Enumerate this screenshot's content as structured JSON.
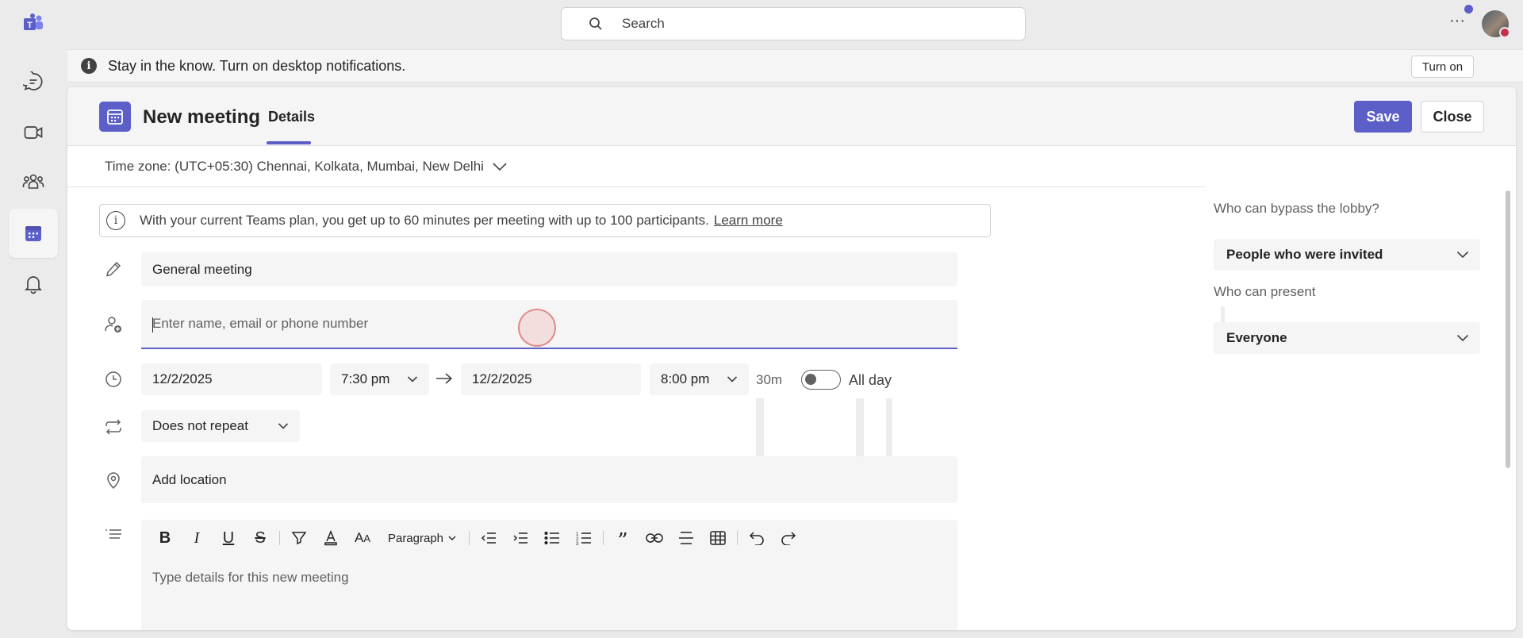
{
  "search": {
    "placeholder": "Search"
  },
  "banner": {
    "text": "Stay in the know. Turn on desktop notifications.",
    "button": "Turn on"
  },
  "header": {
    "title": "New meeting",
    "tab": "Details",
    "save": "Save",
    "close": "Close"
  },
  "timezone": {
    "label": "Time zone: (UTC+05:30) Chennai, Kolkata, Mumbai, New Delhi"
  },
  "info": {
    "text": "With your current Teams plan, you get up to 60 minutes per meeting with up to 100 participants.",
    "link": "Learn more"
  },
  "form": {
    "title_value": "General meeting",
    "attendees_placeholder": "Enter name, email or phone number",
    "start_date": "12/2/2025",
    "start_time": "7:30 pm",
    "end_date": "12/2/2025",
    "end_time": "8:00 pm",
    "duration": "30m",
    "all_day_label": "All day",
    "all_day_on": false,
    "repeat": "Does not repeat",
    "location_placeholder": "Add location",
    "details_placeholder": "Type details for this new meeting",
    "paragraph_style": "Paragraph"
  },
  "side": {
    "lobby_label": "Who can bypass the lobby?",
    "lobby_value": "People who were invited",
    "present_label": "Who can present",
    "present_value": "Everyone"
  },
  "colors": {
    "accent": "#5b5fc7",
    "status_busy": "#c4314b"
  }
}
